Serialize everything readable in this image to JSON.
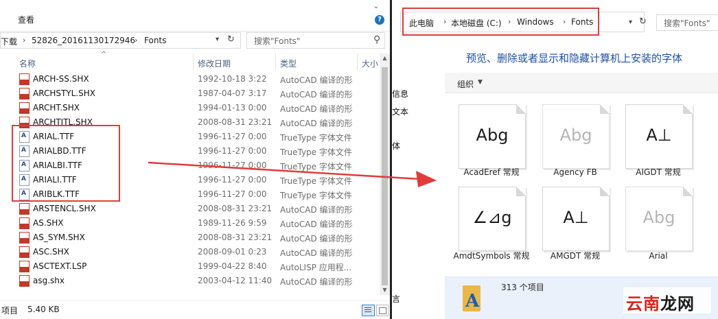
{
  "left": {
    "ribbon_tab": "查看",
    "address": {
      "crumbs": [
        "下载",
        "52826_20161130172946",
        "Fonts"
      ]
    },
    "search_placeholder": "搜索\"Fonts\"",
    "columns": {
      "name": "名称",
      "date": "修改日期",
      "type": "类型",
      "size": "大小"
    },
    "rows": [
      {
        "icon": "shx",
        "name": "ARCH-SS.SHX",
        "date": "1992-10-18 3:22",
        "type": "AutoCAD 编译的形"
      },
      {
        "icon": "shx",
        "name": "ARCHSTYL.SHX",
        "date": "1987-04-07 3:17",
        "type": "AutoCAD 编译的形"
      },
      {
        "icon": "shx",
        "name": "ARCHT.SHX",
        "date": "1994-01-13 0:00",
        "type": "AutoCAD 编译的形"
      },
      {
        "icon": "shx",
        "name": "ARCHTITL.SHX",
        "date": "2008-08-31 23:21",
        "type": "AutoCAD 编译的形"
      },
      {
        "icon": "ttf",
        "name": "ARIAL.TTF",
        "date": "1996-11-27 0:00",
        "type": "TrueType 字体文件"
      },
      {
        "icon": "ttf",
        "name": "ARIALBD.TTF",
        "date": "1996-11-27 0:00",
        "type": "TrueType 字体文件"
      },
      {
        "icon": "ttf",
        "name": "ARIALBI.TTF",
        "date": "1996-11-27 0:00",
        "type": "TrueType 字体文件"
      },
      {
        "icon": "ttf",
        "name": "ARIALI.TTF",
        "date": "1996-11-27 0:00",
        "type": "TrueType 字体文件"
      },
      {
        "icon": "ttf",
        "name": "ARIBLK.TTF",
        "date": "1996-11-27 0:00",
        "type": "TrueType 字体文件"
      },
      {
        "icon": "shx",
        "name": "ARSTENCL.SHX",
        "date": "2008-08-31 23:21",
        "type": "AutoCAD 编译的形"
      },
      {
        "icon": "shx",
        "name": "AS.SHX",
        "date": "1989-11-26 9:59",
        "type": "AutoCAD 编译的形"
      },
      {
        "icon": "shx",
        "name": "AS_SYM.SHX",
        "date": "2008-08-31 23:21",
        "type": "AutoCAD 编译的形"
      },
      {
        "icon": "shx",
        "name": "ASC.SHX",
        "date": "2008-09-01 0:23",
        "type": "AutoCAD 编译的形"
      },
      {
        "icon": "lsp",
        "name": "ASCTEXT.LSP",
        "date": "1999-04-22 8:40",
        "type": "AutoLISP 应用程..."
      },
      {
        "icon": "shx",
        "name": "asg.shx",
        "date": "2003-04-12 11:40",
        "type": "AutoCAD 编译的形"
      }
    ],
    "status": {
      "items": "项目",
      "size": "5.40 KB"
    }
  },
  "right": {
    "side_labels": [
      "信息",
      "文本",
      "体",
      "言"
    ],
    "address": {
      "crumbs": [
        "此电脑",
        "本地磁盘 (C:)",
        "Windows",
        "Fonts"
      ]
    },
    "search_placeholder": "搜索\"Fonts\"",
    "heading": "预览、删除或者显示和隐藏计算机上安装的字体",
    "toolbar_organize": "组织",
    "tiles": [
      {
        "sample": "Abg",
        "label": "AcadEref 常规",
        "ghost": false
      },
      {
        "sample": "Abg",
        "label": "Agency FB",
        "ghost": true
      },
      {
        "sample": "A⊥",
        "label": "AIGDT 常规",
        "ghost": false
      },
      {
        "sample": "∠⊿g",
        "label": "AmdtSymbols 常规",
        "ghost": false
      },
      {
        "sample": "A⊥",
        "label": "AMGDT 常规",
        "ghost": false
      },
      {
        "sample": "Abg",
        "label": "Arial",
        "ghost": true
      }
    ],
    "status_count": "313 个项目"
  },
  "watermark": {
    "part1": "云南",
    "part2": "龙网"
  }
}
